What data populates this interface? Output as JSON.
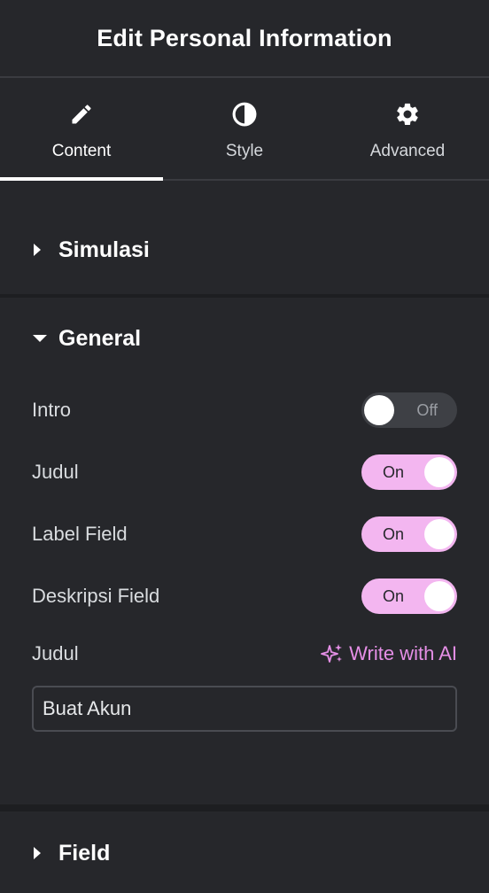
{
  "header": {
    "title": "Edit Personal Information"
  },
  "tabs": [
    {
      "label": "Content",
      "icon": "pencil-icon",
      "active": true
    },
    {
      "label": "Style",
      "icon": "contrast-icon",
      "active": false
    },
    {
      "label": "Advanced",
      "icon": "gear-icon",
      "active": false
    }
  ],
  "sections": {
    "simulasi": {
      "title": "Simulasi",
      "expanded": false
    },
    "general": {
      "title": "General",
      "expanded": true,
      "toggles": [
        {
          "label": "Intro",
          "state": "Off"
        },
        {
          "label": "Judul",
          "state": "On"
        },
        {
          "label": "Label Field",
          "state": "On"
        },
        {
          "label": "Deskripsi Field",
          "state": "On"
        }
      ],
      "judul_label": "Judul",
      "ai_link": "Write with AI",
      "judul_value": "Buat Akun"
    },
    "field": {
      "title": "Field",
      "expanded": false
    }
  },
  "colors": {
    "background": "#26272b",
    "toggle_on": "#f3b6f0",
    "toggle_off": "#3e4045",
    "ai_accent": "#e58fe6"
  }
}
